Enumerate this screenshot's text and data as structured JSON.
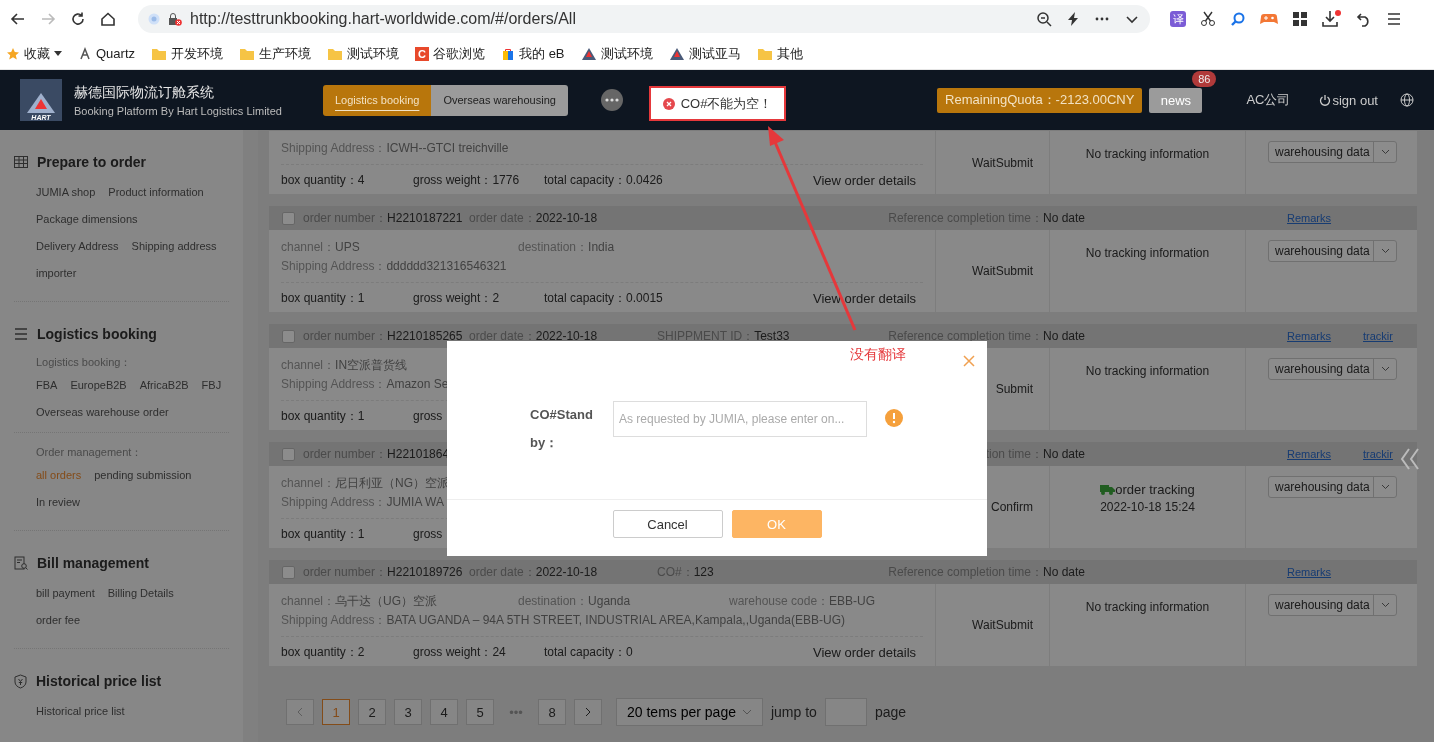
{
  "browser": {
    "url": "http://testtrunkbooking.hart-worldwide.com/#/orders/All",
    "translate_label": "译",
    "bookmarks": [
      {
        "label": "收藏",
        "kind": "star"
      },
      {
        "label": "Quartz",
        "kind": "site"
      },
      {
        "label": "开发环境",
        "kind": "folder"
      },
      {
        "label": "生产环境",
        "kind": "folder"
      },
      {
        "label": "测试环境",
        "kind": "folder"
      },
      {
        "label": "谷歌浏览",
        "kind": "letter",
        "letter": "C"
      },
      {
        "label": "我的 eB",
        "kind": "bag"
      },
      {
        "label": "测试环境",
        "kind": "logo"
      },
      {
        "label": "测试亚马",
        "kind": "logo"
      },
      {
        "label": "其他",
        "kind": "folder"
      }
    ]
  },
  "header": {
    "logo": "HART",
    "title": "赫德国际物流订舱系统",
    "subtitle": "Booking Platform By Hart Logistics Limited",
    "tabs": [
      {
        "label": "Logistics booking",
        "selected": true
      },
      {
        "label": "Overseas warehousing",
        "selected": false
      }
    ],
    "quota": "RemainingQuota：-2123.00CNY",
    "news": "news",
    "news_badge": "86",
    "company": "AC公司",
    "sign_out": "sign out"
  },
  "toast": {
    "message": "CO#不能为空！"
  },
  "annotation": {
    "note": "没有翻译"
  },
  "sidebar": {
    "sections": [
      {
        "title": "Prepare to order",
        "groups": [
          {
            "items": [
              {
                "label": "JUMIA shop",
                "selected": false
              },
              {
                "label": "Product information",
                "selected": false
              },
              {
                "label": "Package dimensions",
                "selected": false
              },
              {
                "label": "Delivery Address",
                "selected": false
              },
              {
                "label": "Shipping address",
                "selected": false
              },
              {
                "label": "importer",
                "selected": false
              }
            ]
          }
        ]
      },
      {
        "title": "Logistics booking",
        "groups": [
          {
            "label": "Logistics booking：",
            "items": [
              {
                "label": "FBA",
                "selected": false
              },
              {
                "label": "EuropeB2B",
                "selected": false
              },
              {
                "label": "AfricaB2B",
                "selected": false
              },
              {
                "label": "FBJ",
                "selected": false
              },
              {
                "label": "Overseas warehouse order",
                "selected": false
              }
            ]
          },
          {
            "label": "Order management：",
            "items": [
              {
                "label": "all orders",
                "selected": true
              },
              {
                "label": "pending submission",
                "selected": false
              },
              {
                "label": "In review",
                "selected": false
              }
            ]
          }
        ]
      },
      {
        "title": "Bill management",
        "groups": [
          {
            "items": [
              {
                "label": "bill payment",
                "selected": false
              },
              {
                "label": "Billing Details",
                "selected": false
              },
              {
                "label": "order fee",
                "selected": false
              }
            ]
          }
        ]
      },
      {
        "title": "Historical price list",
        "groups": [
          {
            "items": [
              {
                "label": "Historical price list",
                "selected": false
              }
            ]
          }
        ]
      }
    ]
  },
  "orders": [
    {
      "address": {
        "label": "Shipping Address：",
        "value": "ICWH--GTCI treichville"
      },
      "line3": [
        {
          "label": "box quantity：",
          "value": "4"
        },
        {
          "label": "gross weight：",
          "value": "1776"
        },
        {
          "label": "total capacity：",
          "value": "0.0426"
        }
      ],
      "details": "View order details",
      "status": "WaitSubmit",
      "tracking": {
        "kind": "none",
        "text": "No tracking information"
      },
      "action": "warehousing data"
    },
    {
      "checked": false,
      "head": [
        {
          "label": "order number：",
          "value": "H2210187221"
        },
        {
          "label": "order date：",
          "value": "2022-10-18"
        }
      ],
      "ref_label": "Reference completion time：",
      "ref_value": "No date",
      "links": [
        "Remarks"
      ],
      "line1": [
        {
          "label": "channel：",
          "value": "UPS"
        },
        {
          "label": "destination：",
          "value": "India"
        }
      ],
      "address": {
        "label": "Shipping Address：",
        "value": "dddddd321316546321"
      },
      "line3": [
        {
          "label": "box quantity：",
          "value": "1"
        },
        {
          "label": "gross weight：",
          "value": "2"
        },
        {
          "label": "total capacity：",
          "value": "0.0015"
        }
      ],
      "details": "View order details",
      "status": "WaitSubmit",
      "tracking": {
        "kind": "none",
        "text": "No tracking information"
      },
      "action": "warehousing data"
    },
    {
      "checked": false,
      "head": [
        {
          "label": "order number：",
          "value": "H2210185265"
        },
        {
          "label": "order date：",
          "value": "2022-10-18"
        },
        {
          "label": "SHIPPMENT ID：",
          "value": "Test33"
        }
      ],
      "ref_label": "Reference completion time：",
      "ref_value": "No date",
      "links": [
        "Remarks",
        "trackir"
      ],
      "line1": [
        {
          "label": "channel：",
          "value": "IN空派普货线"
        }
      ],
      "address": {
        "label": "Shipping Address：",
        "value": "Amazon Se"
      },
      "line3": [
        {
          "label": "box quantity：",
          "value": "1"
        },
        {
          "label": "gross"
        }
      ],
      "status": "Submit",
      "tracking": {
        "kind": "none",
        "text": "No tracking information"
      },
      "action": "warehousing data"
    },
    {
      "checked": false,
      "head": [
        {
          "label": "order number：",
          "value": "H22101864"
        }
      ],
      "ref_label": "tion time：",
      "ref_value": "No date",
      "links": [
        "Remarks",
        "trackir"
      ],
      "line1": [
        {
          "label": "channel：",
          "value": "尼日利亚（NG）空派"
        }
      ],
      "address": {
        "label": "Shipping Address：",
        "value": "JUMIA WA"
      },
      "line3": [
        {
          "label": "box quantity：",
          "value": "1"
        },
        {
          "label": "gross"
        }
      ],
      "status": "Confirm",
      "tracking": {
        "kind": "tracking",
        "text": "order tracking",
        "time": "2022-10-18 15:24"
      },
      "action": "warehousing data"
    },
    {
      "checked": false,
      "head": [
        {
          "label": "order number：",
          "value": "H2210189726"
        },
        {
          "label": "order date：",
          "value": "2022-10-18"
        },
        {
          "label": "CO#：",
          "value": "123"
        }
      ],
      "ref_label": "Reference completion time：",
      "ref_value": "No date",
      "links": [
        "Remarks"
      ],
      "line1": [
        {
          "label": "channel：",
          "value": "乌干达（UG）空派"
        },
        {
          "label": "destination：",
          "value": "Uganda"
        },
        {
          "label": "warehouse code：",
          "value": "EBB-UG"
        }
      ],
      "address": {
        "label": "Shipping Address：",
        "value": "BATA UGANDA – 94A 5TH STREET, INDUSTRIAL AREA,Kampala,,Uganda(EBB-UG)"
      },
      "line3": [
        {
          "label": "box quantity：",
          "value": "2"
        },
        {
          "label": "gross weight：",
          "value": "24"
        },
        {
          "label": "total capacity：",
          "value": "0"
        }
      ],
      "details": "View order details",
      "status": "WaitSubmit",
      "tracking": {
        "kind": "none",
        "text": "No tracking information"
      },
      "action": "warehousing data"
    }
  ],
  "pagination": {
    "pages": [
      {
        "label": "1",
        "kind": "page",
        "selected": true
      },
      {
        "label": "2",
        "kind": "page",
        "selected": false
      },
      {
        "label": "3",
        "kind": "page",
        "selected": false
      },
      {
        "label": "4",
        "kind": "page",
        "selected": false
      },
      {
        "label": "5",
        "kind": "page",
        "selected": false
      },
      {
        "label": "•••",
        "kind": "ellipsis"
      },
      {
        "label": "8",
        "kind": "page",
        "selected": false
      }
    ],
    "per_page": "20 tems per page",
    "jump_label": "jump to",
    "page_label": "page"
  },
  "dialog": {
    "label": "CO#Stand by：",
    "placeholder": "As requested by JUMIA, please enter on...",
    "cancel": "Cancel",
    "ok": "OK"
  }
}
